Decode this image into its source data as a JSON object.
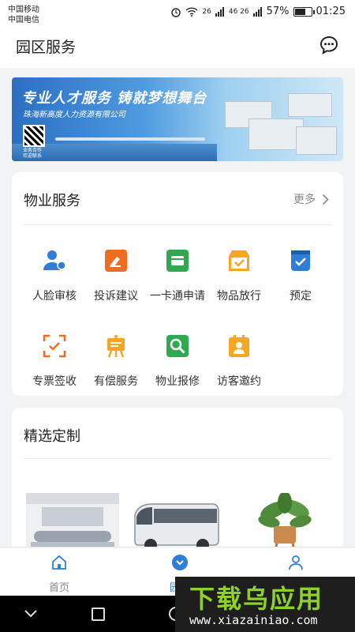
{
  "status_bar": {
    "carrier1": "中国移动",
    "carrier2": "中国电信",
    "network1": "26",
    "network2": "46 26",
    "battery": "57%",
    "time": "01:25"
  },
  "header": {
    "title": "园区服务",
    "chat_icon": "chat-bubble-icon"
  },
  "banner": {
    "slogan": "专业人才服务 铸就梦想舞台",
    "company": "珠海新高度人力资源有限公司",
    "qr_note_1": "业务合作",
    "qr_note_2": "欢迎联系"
  },
  "property_section": {
    "title": "物业服务",
    "more_label": "更多",
    "items": [
      {
        "label": "人脸审核",
        "icon": "face-audit-icon",
        "color": "#2e7ed6"
      },
      {
        "label": "投诉建议",
        "icon": "complaint-icon",
        "color": "#ef6c23"
      },
      {
        "label": "一卡通申请",
        "icon": "card-apply-icon",
        "color": "#2fa84f"
      },
      {
        "label": "物品放行",
        "icon": "item-release-icon",
        "color": "#f5a623"
      },
      {
        "label": "预定",
        "icon": "reservation-icon",
        "color": "#2e7ed6"
      },
      {
        "label": "专票签收",
        "icon": "invoice-scan-icon",
        "color": "#ef6c23"
      },
      {
        "label": "有偿服务",
        "icon": "paid-service-icon",
        "color": "#f5a623"
      },
      {
        "label": "物业报修",
        "icon": "repair-icon",
        "color": "#2fa84f"
      },
      {
        "label": "访客邀约",
        "icon": "visitor-icon",
        "color": "#f5a623"
      }
    ]
  },
  "featured_section": {
    "title": "精选定制"
  },
  "tabs": [
    {
      "label": "首页",
      "icon": "home-icon"
    },
    {
      "label": "园区",
      "icon": "park-icon"
    },
    {
      "label": "",
      "icon": "user-icon"
    }
  ],
  "watermark": {
    "text": "下载乌应用",
    "url": "www.xiazainiao.com"
  }
}
